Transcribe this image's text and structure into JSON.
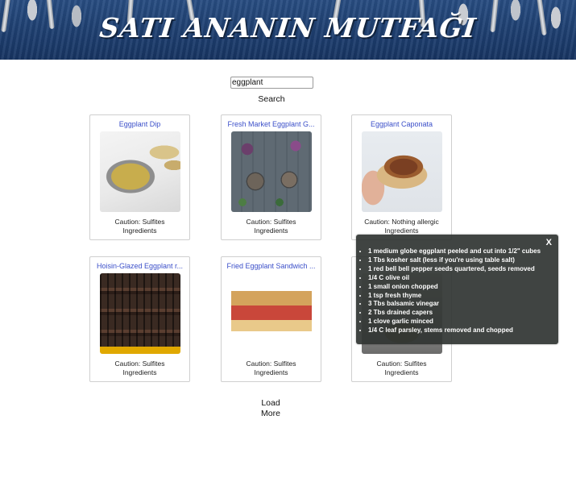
{
  "header": {
    "title": "SATI ANANIN MUTFAĞI"
  },
  "search": {
    "value": "eggplant",
    "button_label": "Search"
  },
  "recipes": [
    {
      "title": "Eggplant Dip",
      "caution": "Caution: Sulfites",
      "ingredients_label": "Ingredients"
    },
    {
      "title": "Fresh Market Eggplant G...",
      "caution": "Caution: Sulfites",
      "ingredients_label": "Ingredients"
    },
    {
      "title": "Eggplant Caponata",
      "caution": "Caution: Nothing allergic",
      "ingredients_label": "Ingredients"
    },
    {
      "title": "Hoisin-Glazed Eggplant r...",
      "caution": "Caution: Sulfites",
      "ingredients_label": "Ingredients"
    },
    {
      "title": "Fried Eggplant Sandwich ...",
      "caution": "Caution: Sulfites",
      "ingredients_label": "Ingredients"
    },
    {
      "title": "",
      "caution": "Caution: Sulfites",
      "ingredients_label": "Ingredients"
    }
  ],
  "load_more": {
    "line1": "Load",
    "line2": "More"
  },
  "popup": {
    "close_label": "X",
    "items": [
      "1 medium globe eggplant peeled and cut into 1/2\" cubes",
      "1 Tbs kosher salt (less if you're using table salt)",
      "1 red bell bell pepper seeds quartered, seeds removed",
      "1/4 C olive oil",
      "1 small onion chopped",
      "1 tsp fresh thyme",
      "3 Tbs balsamic vinegar",
      "2 Tbs drained capers",
      "1 clove garlic minced",
      "1/4 C leaf parsley, stems removed and chopped"
    ]
  },
  "colors": {
    "link": "#3b4fc9",
    "banner": "#1e3f70",
    "popup_bg": "#303432"
  },
  "icons": {
    "close": "close-icon"
  }
}
